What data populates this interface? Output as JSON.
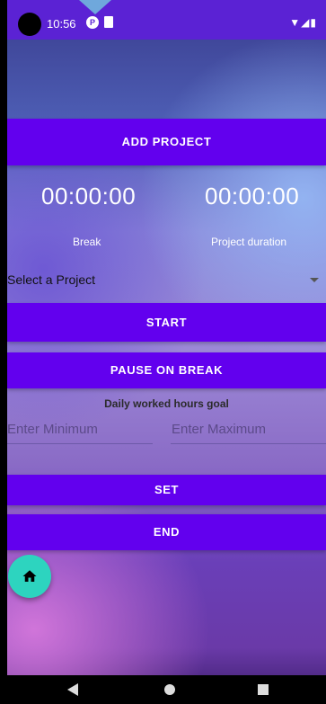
{
  "status_bar": {
    "time": "10:56",
    "icons": [
      "privacy-icon",
      "sd-card-icon",
      "wifi-icon",
      "signal-icon",
      "battery-icon"
    ]
  },
  "buttons": {
    "add_project": "ADD PROJECT",
    "start": "START",
    "pause_on_break": "PAUSE ON BREAK",
    "set": "SET",
    "end": "END"
  },
  "timers": {
    "break_time": "00:00:00",
    "break_label": "Break",
    "project_time": "00:00:00",
    "project_label": "Project duration"
  },
  "project_select": {
    "value": "Select a Project"
  },
  "goal": {
    "title": "Daily worked hours goal",
    "min_placeholder": "Enter Minimum",
    "max_placeholder": "Enter Maximum"
  },
  "colors": {
    "primary": "#6200ee",
    "fab": "#2dd4bf"
  },
  "nav": {
    "icons": [
      "back-icon",
      "home-icon",
      "recents-icon"
    ]
  }
}
